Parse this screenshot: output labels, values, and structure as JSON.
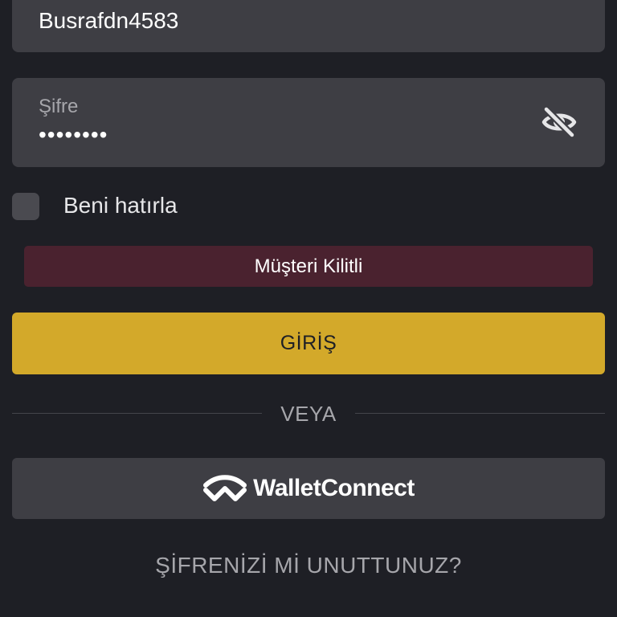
{
  "username": {
    "value": "Busrafdn4583"
  },
  "password": {
    "label": "Şifre",
    "masked_value": "••••••••",
    "toggle_icon": "eye-off-icon"
  },
  "remember": {
    "label": "Beni hatırla",
    "checked": false
  },
  "alert": {
    "text": "Müşteri Kilitli",
    "color": "#4a222f"
  },
  "login_button": {
    "label": "GİRİŞ",
    "color": "#d3a92a"
  },
  "divider": {
    "text": "VEYA"
  },
  "walletconnect": {
    "label": "WalletConnect",
    "icon": "walletconnect-icon"
  },
  "forgot_password": {
    "label": "ŞİFRENİZİ Mİ UNUTTUNUZ?"
  },
  "colors": {
    "background": "#1e1f25",
    "field": "#3e3e44",
    "muted_text": "#a6a6ab"
  }
}
